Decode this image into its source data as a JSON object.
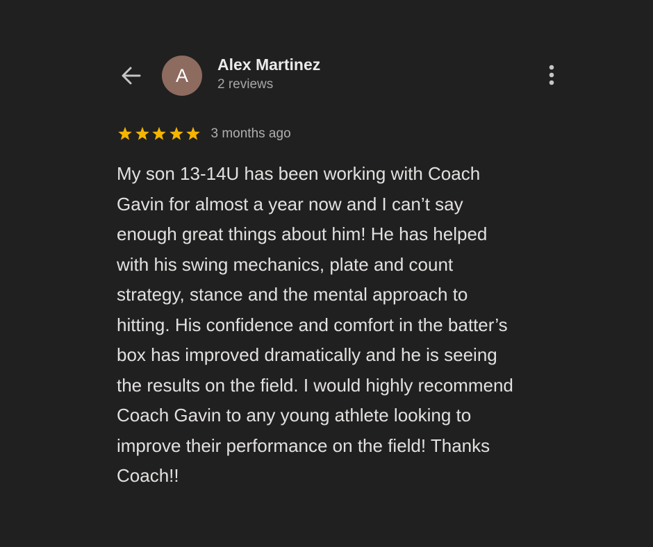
{
  "header": {
    "avatar_letter": "A",
    "reviewer_name": "Alex Martinez",
    "review_count": "2 reviews",
    "back_icon": "arrow-left-icon",
    "more_icon": "more-vertical-icon"
  },
  "rating": {
    "stars": 5,
    "max_stars": 5,
    "time_ago": "3 months ago",
    "star_color": "#f5b400"
  },
  "review": {
    "lines": [
      "My son 13-14U has been working with Coach",
      "Gavin for almost a year now and I can’t say",
      "enough great things about him! He has helped",
      "with his swing mechanics, plate and count",
      "strategy, stance and the mental approach to",
      "hitting. His confidence and comfort in the batter’s",
      "box has improved dramatically and he is seeing",
      "the results on the field. I would highly recommend",
      "Coach Gavin to any young athlete looking to",
      "improve their performance on the field! Thanks",
      "Coach!!"
    ]
  },
  "colors": {
    "background": "#202020",
    "avatar_bg": "#8e6b5f",
    "primary_text": "#e3e1e0",
    "secondary_text": "#a9a7a6"
  }
}
